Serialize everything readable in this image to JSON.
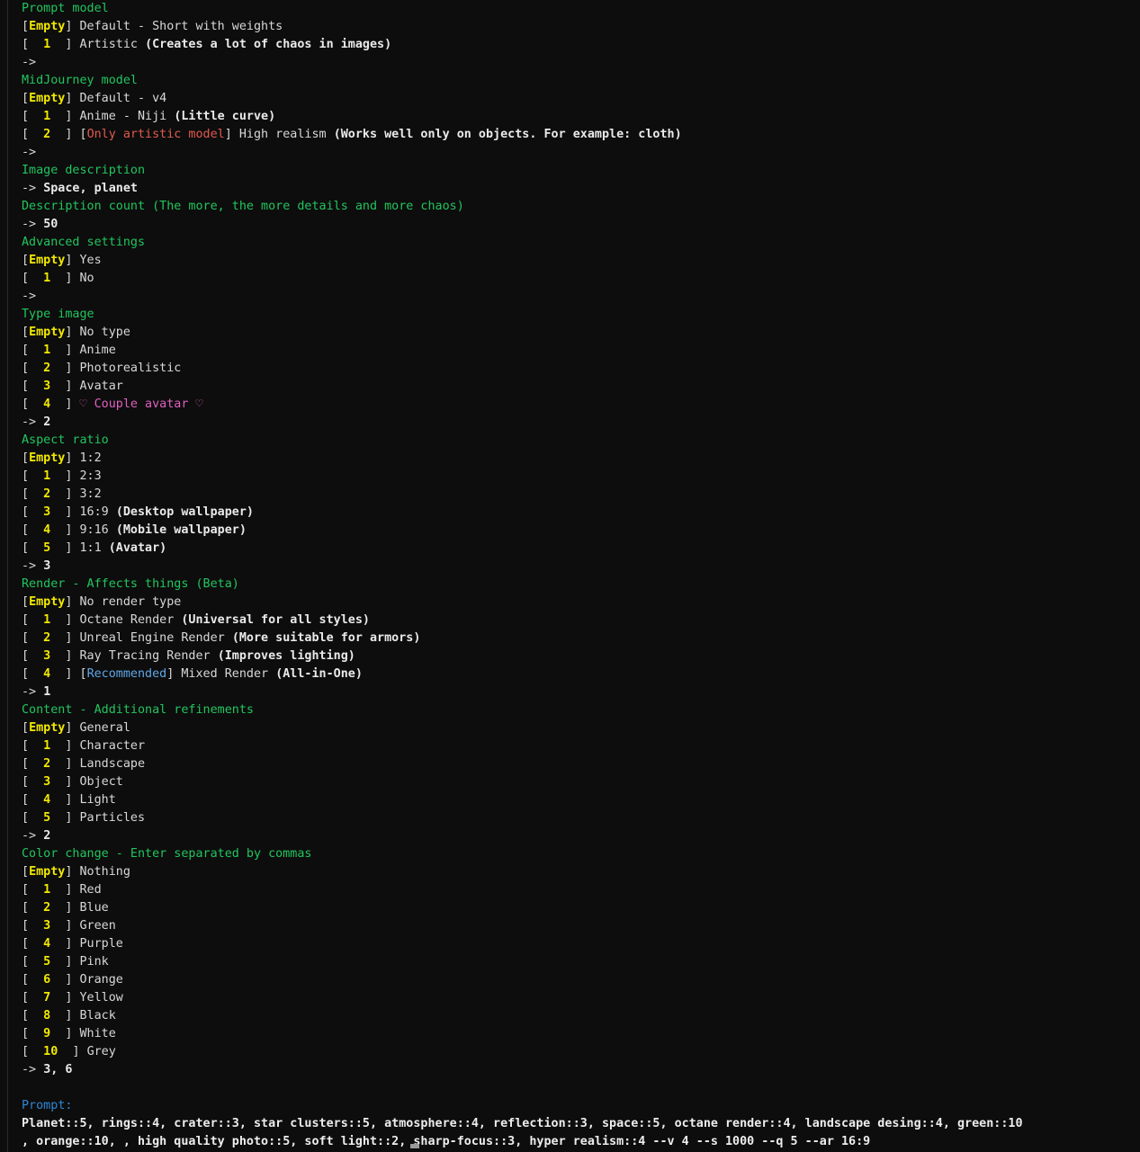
{
  "terminal": {
    "background": "#0d0d0d",
    "colors": {
      "header_green": "#22c55e",
      "option_yellow": "#f2e900",
      "body_white": "#d8d8d8",
      "bold_white": "#eaeaea",
      "warning_red": "#e05a4f",
      "accent_pink": "#e060c0",
      "recommended_blue": "#5fa8e8",
      "prompt_label_blue": "#2f86d6"
    }
  },
  "sections": [
    {
      "heading": "Prompt model",
      "options": [
        {
          "key": "[Empty]",
          "key_style": "empty",
          "label": "Default - Short with weights",
          "note": ""
        },
        {
          "key": "[  1  ]",
          "key_style": "num",
          "label": "Artistic ",
          "note": "(Creates a lot of chaos in images)"
        }
      ],
      "answer_arrow": "->",
      "answer_value": ""
    },
    {
      "heading": "MidJourney model",
      "options": [
        {
          "key": "[Empty]",
          "key_style": "empty",
          "label": "Default - v4",
          "note": ""
        },
        {
          "key": "[  1  ]",
          "key_style": "num",
          "label": "Anime - Niji ",
          "note": "(Little curve)"
        },
        {
          "key": "[  2  ]",
          "key_style": "num",
          "tag": "[Only artistic model]",
          "tag_style": "red",
          "label": " High realism ",
          "note": "(Works well only on objects. For example: cloth)"
        }
      ],
      "answer_arrow": "->",
      "answer_value": ""
    },
    {
      "heading": "Image description",
      "options": [],
      "answer_arrow": "->",
      "answer_value": "Space, planet"
    },
    {
      "heading": "Description count (The more, the more details and more chaos)",
      "options": [],
      "answer_arrow": "->",
      "answer_value": "50"
    },
    {
      "heading": "Advanced settings",
      "options": [
        {
          "key": "[Empty]",
          "key_style": "empty",
          "label": "Yes",
          "note": ""
        },
        {
          "key": "[  1  ]",
          "key_style": "num",
          "label": "No",
          "note": ""
        }
      ],
      "answer_arrow": "->",
      "answer_value": ""
    },
    {
      "heading": "Type image",
      "options": [
        {
          "key": "[Empty]",
          "key_style": "empty",
          "label": "No type",
          "note": ""
        },
        {
          "key": "[  1  ]",
          "key_style": "num",
          "label": "Anime",
          "note": ""
        },
        {
          "key": "[  2  ]",
          "key_style": "num",
          "label": "Photorealistic",
          "note": ""
        },
        {
          "key": "[  3  ]",
          "key_style": "num",
          "label": "Avatar",
          "note": ""
        },
        {
          "key": "[  4  ]",
          "key_style": "num",
          "label": "♡ Couple avatar ♡",
          "label_style": "pink",
          "note": ""
        }
      ],
      "answer_arrow": "->",
      "answer_value": "2"
    },
    {
      "heading": "Aspect ratio",
      "options": [
        {
          "key": "[Empty]",
          "key_style": "empty",
          "label": "1:2",
          "note": ""
        },
        {
          "key": "[  1  ]",
          "key_style": "num",
          "label": "2:3",
          "note": ""
        },
        {
          "key": "[  2  ]",
          "key_style": "num",
          "label": "3:2",
          "note": ""
        },
        {
          "key": "[  3  ]",
          "key_style": "num",
          "label": "16:9 ",
          "note": "(Desktop wallpaper)"
        },
        {
          "key": "[  4  ]",
          "key_style": "num",
          "label": "9:16 ",
          "note": "(Mobile wallpaper)"
        },
        {
          "key": "[  5  ]",
          "key_style": "num",
          "label": "1:1 ",
          "note": "(Avatar)"
        }
      ],
      "answer_arrow": "->",
      "answer_value": "3"
    },
    {
      "heading": "Render - Affects things (Beta)",
      "options": [
        {
          "key": "[Empty]",
          "key_style": "empty",
          "label": "No render type",
          "note": ""
        },
        {
          "key": "[  1  ]",
          "key_style": "num",
          "label": "Octane Render ",
          "note": "(Universal for all styles)"
        },
        {
          "key": "[  2  ]",
          "key_style": "num",
          "label": "Unreal Engine Render ",
          "note": "(More suitable for armors)"
        },
        {
          "key": "[  3  ]",
          "key_style": "num",
          "label": "Ray Tracing Render ",
          "note": "(Improves lighting)"
        },
        {
          "key": "[  4  ]",
          "key_style": "num",
          "tag": "[Recommended]",
          "tag_style": "cyan",
          "label": " Mixed Render ",
          "note": "(All-in-One)"
        }
      ],
      "answer_arrow": "->",
      "answer_value": "1"
    },
    {
      "heading": "Content - Additional refinements",
      "options": [
        {
          "key": "[Empty]",
          "key_style": "empty",
          "label": "General",
          "note": ""
        },
        {
          "key": "[  1  ]",
          "key_style": "num",
          "label": "Character",
          "note": ""
        },
        {
          "key": "[  2  ]",
          "key_style": "num",
          "label": "Landscape",
          "note": ""
        },
        {
          "key": "[  3  ]",
          "key_style": "num",
          "label": "Object",
          "note": ""
        },
        {
          "key": "[  4  ]",
          "key_style": "num",
          "label": "Light",
          "note": ""
        },
        {
          "key": "[  5  ]",
          "key_style": "num",
          "label": "Particles",
          "note": ""
        }
      ],
      "answer_arrow": "->",
      "answer_value": "2"
    },
    {
      "heading": "Color change - Enter separated by commas",
      "options": [
        {
          "key": "[Empty]",
          "key_style": "empty",
          "label": "Nothing",
          "note": ""
        },
        {
          "key": "[  1  ]",
          "key_style": "num",
          "label": "Red",
          "note": ""
        },
        {
          "key": "[  2  ]",
          "key_style": "num",
          "label": "Blue",
          "note": ""
        },
        {
          "key": "[  3  ]",
          "key_style": "num",
          "label": "Green",
          "note": ""
        },
        {
          "key": "[  4  ]",
          "key_style": "num",
          "label": "Purple",
          "note": ""
        },
        {
          "key": "[  5  ]",
          "key_style": "num",
          "label": "Pink",
          "note": ""
        },
        {
          "key": "[  6  ]",
          "key_style": "num",
          "label": "Orange",
          "note": ""
        },
        {
          "key": "[  7  ]",
          "key_style": "num",
          "label": "Yellow",
          "note": ""
        },
        {
          "key": "[  8  ]",
          "key_style": "num",
          "label": "Black",
          "note": ""
        },
        {
          "key": "[  9  ]",
          "key_style": "num",
          "label": "White",
          "note": ""
        },
        {
          "key": "[  10  ]",
          "key_style": "num",
          "label": "Grey",
          "note": ""
        }
      ],
      "answer_arrow": "->",
      "answer_value": "3, 6"
    }
  ],
  "output": {
    "label": "Prompt:",
    "lines": [
      "Planet::5, rings::4, crater::3, star clusters::5, atmosphere::4, reflection::3, space::5, octane render::4, landscape desing::4, green::10",
      ", orange::10, , high quality photo::5, soft light::2, sharp-focus::3, hyper realism::4 --v 4 --s 1000 --q 5 --ar 16:9"
    ]
  },
  "cursor": {
    "visible": true
  }
}
